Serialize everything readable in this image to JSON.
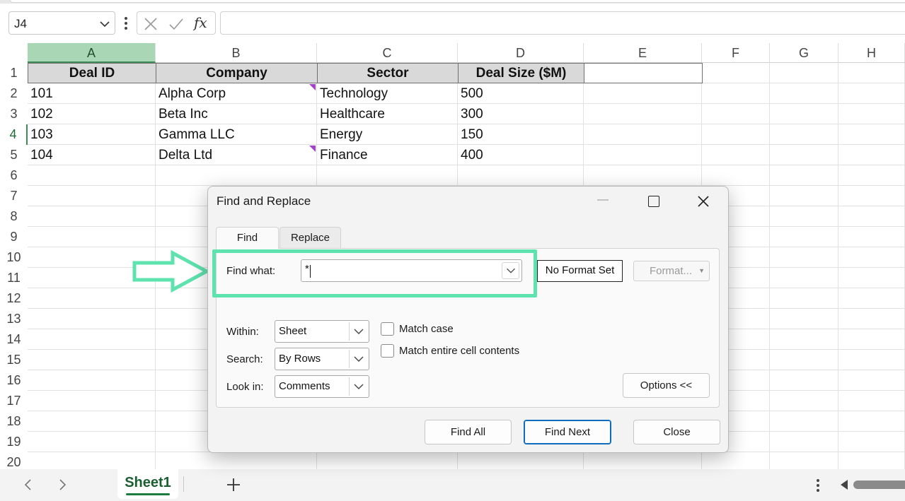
{
  "formula_bar": {
    "name_box": "J4",
    "formula": ""
  },
  "grid": {
    "columns": [
      "A",
      "B",
      "C",
      "D",
      "E",
      "F",
      "G",
      "H"
    ],
    "rows": [
      "1",
      "2",
      "3",
      "4",
      "5",
      "6",
      "7",
      "8",
      "9",
      "10",
      "11",
      "12",
      "13",
      "14",
      "15",
      "16",
      "17",
      "18",
      "19",
      "20"
    ],
    "selected_column": "A",
    "selected_row": "4",
    "headers": [
      "Deal ID",
      "Company",
      "Sector",
      "Deal Size ($M)"
    ],
    "data": [
      [
        "101",
        "Alpha Corp",
        "Technology",
        "500"
      ],
      [
        "102",
        "Beta Inc",
        "Healthcare",
        "300"
      ],
      [
        "103",
        "Gamma LLC",
        "Energy",
        "150"
      ],
      [
        "104",
        "Delta Ltd",
        "Finance",
        "400"
      ]
    ],
    "comment_indicator_color": "#a540c8",
    "header_fill": "#d9d9d9",
    "selection_color": "#a9d7b6"
  },
  "sheet_bar": {
    "active_sheet": "Sheet1",
    "active_color": "#1b7d3d"
  },
  "dialog": {
    "title": "Find and Replace",
    "tabs": [
      "Find",
      "Replace"
    ],
    "active_tab": "Find",
    "find_what_label": "Find what:",
    "find_what_value": "*",
    "no_format_label": "No Format Set",
    "format_button": "Format...",
    "within_label": "Within:",
    "within_value": "Sheet",
    "search_label": "Search:",
    "search_value": "By Rows",
    "look_in_label": "Look in:",
    "look_in_value": "Comments",
    "match_case_label": "Match case",
    "match_entire_label": "Match entire cell contents",
    "match_case_checked": false,
    "match_entire_checked": false,
    "options_button": "Options <<",
    "find_all_button": "Find All",
    "find_next_button": "Find Next",
    "close_button": "Close",
    "primary_color": "#0f6cbd"
  },
  "annotation": {
    "highlight_color": "#5ee3ae"
  }
}
